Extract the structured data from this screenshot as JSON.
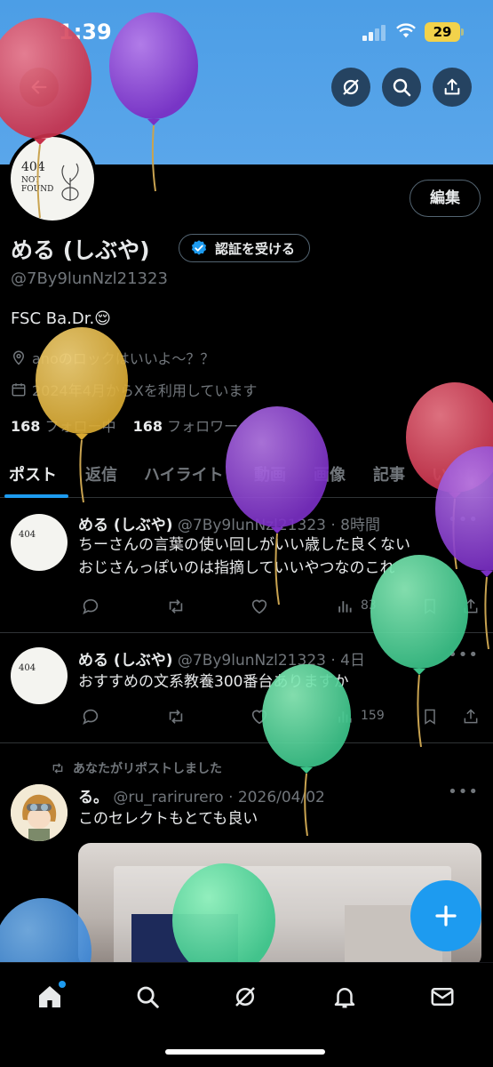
{
  "status_bar": {
    "time": "1:39",
    "battery": "29"
  },
  "profile": {
    "name": "める (しぶや)",
    "verify_label": "認証を受ける",
    "handle": "@7By9lunNzl21323",
    "bio": "FSC Ba.Dr.😌",
    "location": "anoのロックはいいよ〜？？",
    "joined": "2024年4月からXを利用しています",
    "following_count": "168",
    "following_label": "フォロー中",
    "followers_count": "168",
    "followers_label": "フォロワー",
    "edit_label": "編集",
    "avatar_text": "404",
    "avatar_text2": "NOT FOUND"
  },
  "tabs": [
    "ポスト",
    "返信",
    "ハイライト",
    "動画",
    "画像",
    "記事",
    "いいね"
  ],
  "posts": [
    {
      "name": "める (しぶや)",
      "handle": "@7By9lunNzl21323",
      "time": "· 8時間",
      "lines": [
        "ちーさんの言葉の使い回しがいい歳した良くない",
        "おじさんっぽいのは指摘していいやつなのこれ"
      ],
      "views": "83"
    },
    {
      "name": "める (しぶや)",
      "handle": "@7By9lunNzl21323",
      "time": "· 4日",
      "lines": [
        "おすすめの文系教養300番台ありますか"
      ],
      "views": "159"
    },
    {
      "repost_label": "あなたがリポストしました",
      "name": "る。",
      "handle": "@ru_rarirurero",
      "time": "· 2026/04/02",
      "lines": [
        "このセレクトもとても良い"
      ]
    }
  ],
  "colors": {
    "accent": "#1d9bf0",
    "banner": "#4c9ee6",
    "background": "#000000"
  }
}
